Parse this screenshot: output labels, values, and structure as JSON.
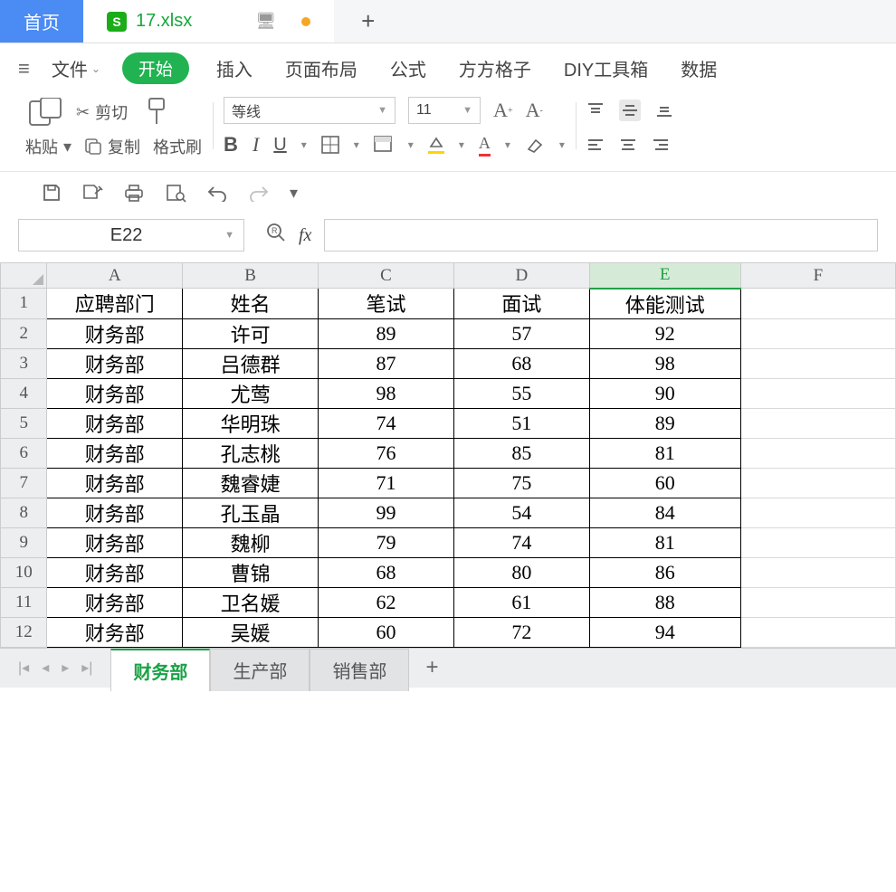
{
  "top": {
    "home": "首页",
    "filename": "17.xlsx",
    "s_letter": "S"
  },
  "menu": {
    "file": "文件",
    "start": "开始",
    "items": [
      "插入",
      "页面布局",
      "公式",
      "方方格子",
      "DIY工具箱",
      "数据"
    ]
  },
  "ribbon": {
    "paste": "粘贴",
    "cut": "剪切",
    "copy": "复制",
    "brush": "格式刷",
    "font_name": "等线",
    "font_size": "11",
    "bold": "B",
    "italic": "I",
    "underline": "U"
  },
  "formula": {
    "namebox": "E22",
    "fx": "fx"
  },
  "columns": [
    "A",
    "B",
    "C",
    "D",
    "E",
    "F"
  ],
  "selected_col_index": 4,
  "header_row": [
    "应聘部门",
    "姓名",
    "笔试",
    "面试",
    "体能测试"
  ],
  "rows": [
    [
      "财务部",
      "许可",
      "89",
      "57",
      "92"
    ],
    [
      "财务部",
      "吕德群",
      "87",
      "68",
      "98"
    ],
    [
      "财务部",
      "尤莺",
      "98",
      "55",
      "90"
    ],
    [
      "财务部",
      "华明珠",
      "74",
      "51",
      "89"
    ],
    [
      "财务部",
      "孔志桃",
      "76",
      "85",
      "81"
    ],
    [
      "财务部",
      "魏睿婕",
      "71",
      "75",
      "60"
    ],
    [
      "财务部",
      "孔玉晶",
      "99",
      "54",
      "84"
    ],
    [
      "财务部",
      "魏柳",
      "79",
      "74",
      "81"
    ],
    [
      "财务部",
      "曹锦",
      "68",
      "80",
      "86"
    ],
    [
      "财务部",
      "卫名媛",
      "62",
      "61",
      "88"
    ],
    [
      "财务部",
      "吴媛",
      "60",
      "72",
      "94"
    ]
  ],
  "sheet_tabs": [
    "财务部",
    "生产部",
    "销售部"
  ],
  "active_sheet_index": 0
}
